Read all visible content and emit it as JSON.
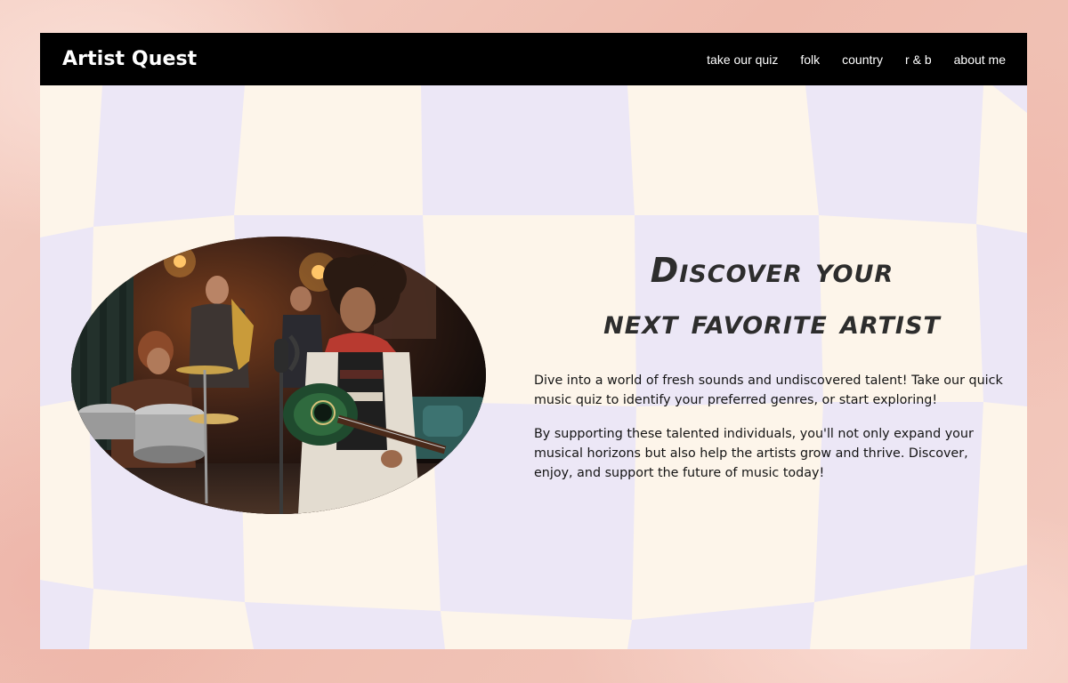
{
  "site": {
    "brand": "Artist Quest"
  },
  "nav": {
    "items": [
      {
        "label": "take our quiz"
      },
      {
        "label": "folk"
      },
      {
        "label": "country"
      },
      {
        "label": "r & b"
      },
      {
        "label": "about me"
      }
    ]
  },
  "hero": {
    "headline_line1": "Discover your",
    "headline_line2": "next favorite artist",
    "paragraph1": "Dive into a world of fresh sounds and undiscovered talent! Take our quick music quiz to identify your preferred genres, or start exploring!",
    "paragraph2": "By supporting these talented individuals, you'll not only expand your musical horizons but also help the artists grow and thrive. Discover, enjoy, and support the future of music today!"
  },
  "colors": {
    "header_bg": "#000000",
    "cream": "#fdf5ea",
    "lavender": "#ece7f6",
    "backdrop": "#f2c7bb",
    "headline": "#2d2d2d"
  }
}
